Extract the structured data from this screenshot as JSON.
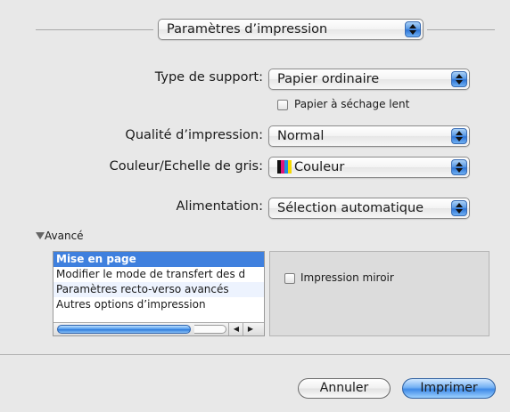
{
  "preset_menu": {
    "value": "Paramètres d’impression"
  },
  "fields": {
    "media_type": {
      "label": "Type de support:",
      "value": "Papier ordinaire"
    },
    "slow_dry": {
      "label": "Papier à séchage lent",
      "checked": false
    },
    "quality": {
      "label": "Qualité d’impression:",
      "value": "Normal"
    },
    "color_mode": {
      "label": "Couleur/Echelle de gris:",
      "value": "Couleur"
    },
    "feed": {
      "label": "Alimentation:",
      "value": "Sélection automatique"
    }
  },
  "advanced": {
    "label": "Avancé",
    "disclosure_icon": "triangle-down-icon",
    "items": [
      {
        "label": "Mise en page",
        "selected": true
      },
      {
        "label": "Modifier le mode de transfert des d",
        "selected": false
      },
      {
        "label": "Paramètres recto-verso avancés",
        "selected": false
      },
      {
        "label": "Autres options d’impression",
        "selected": false
      }
    ],
    "mirror": {
      "label": "Impression miroir",
      "checked": false
    }
  },
  "buttons": {
    "cancel": "Annuler",
    "print": "Imprimer"
  }
}
